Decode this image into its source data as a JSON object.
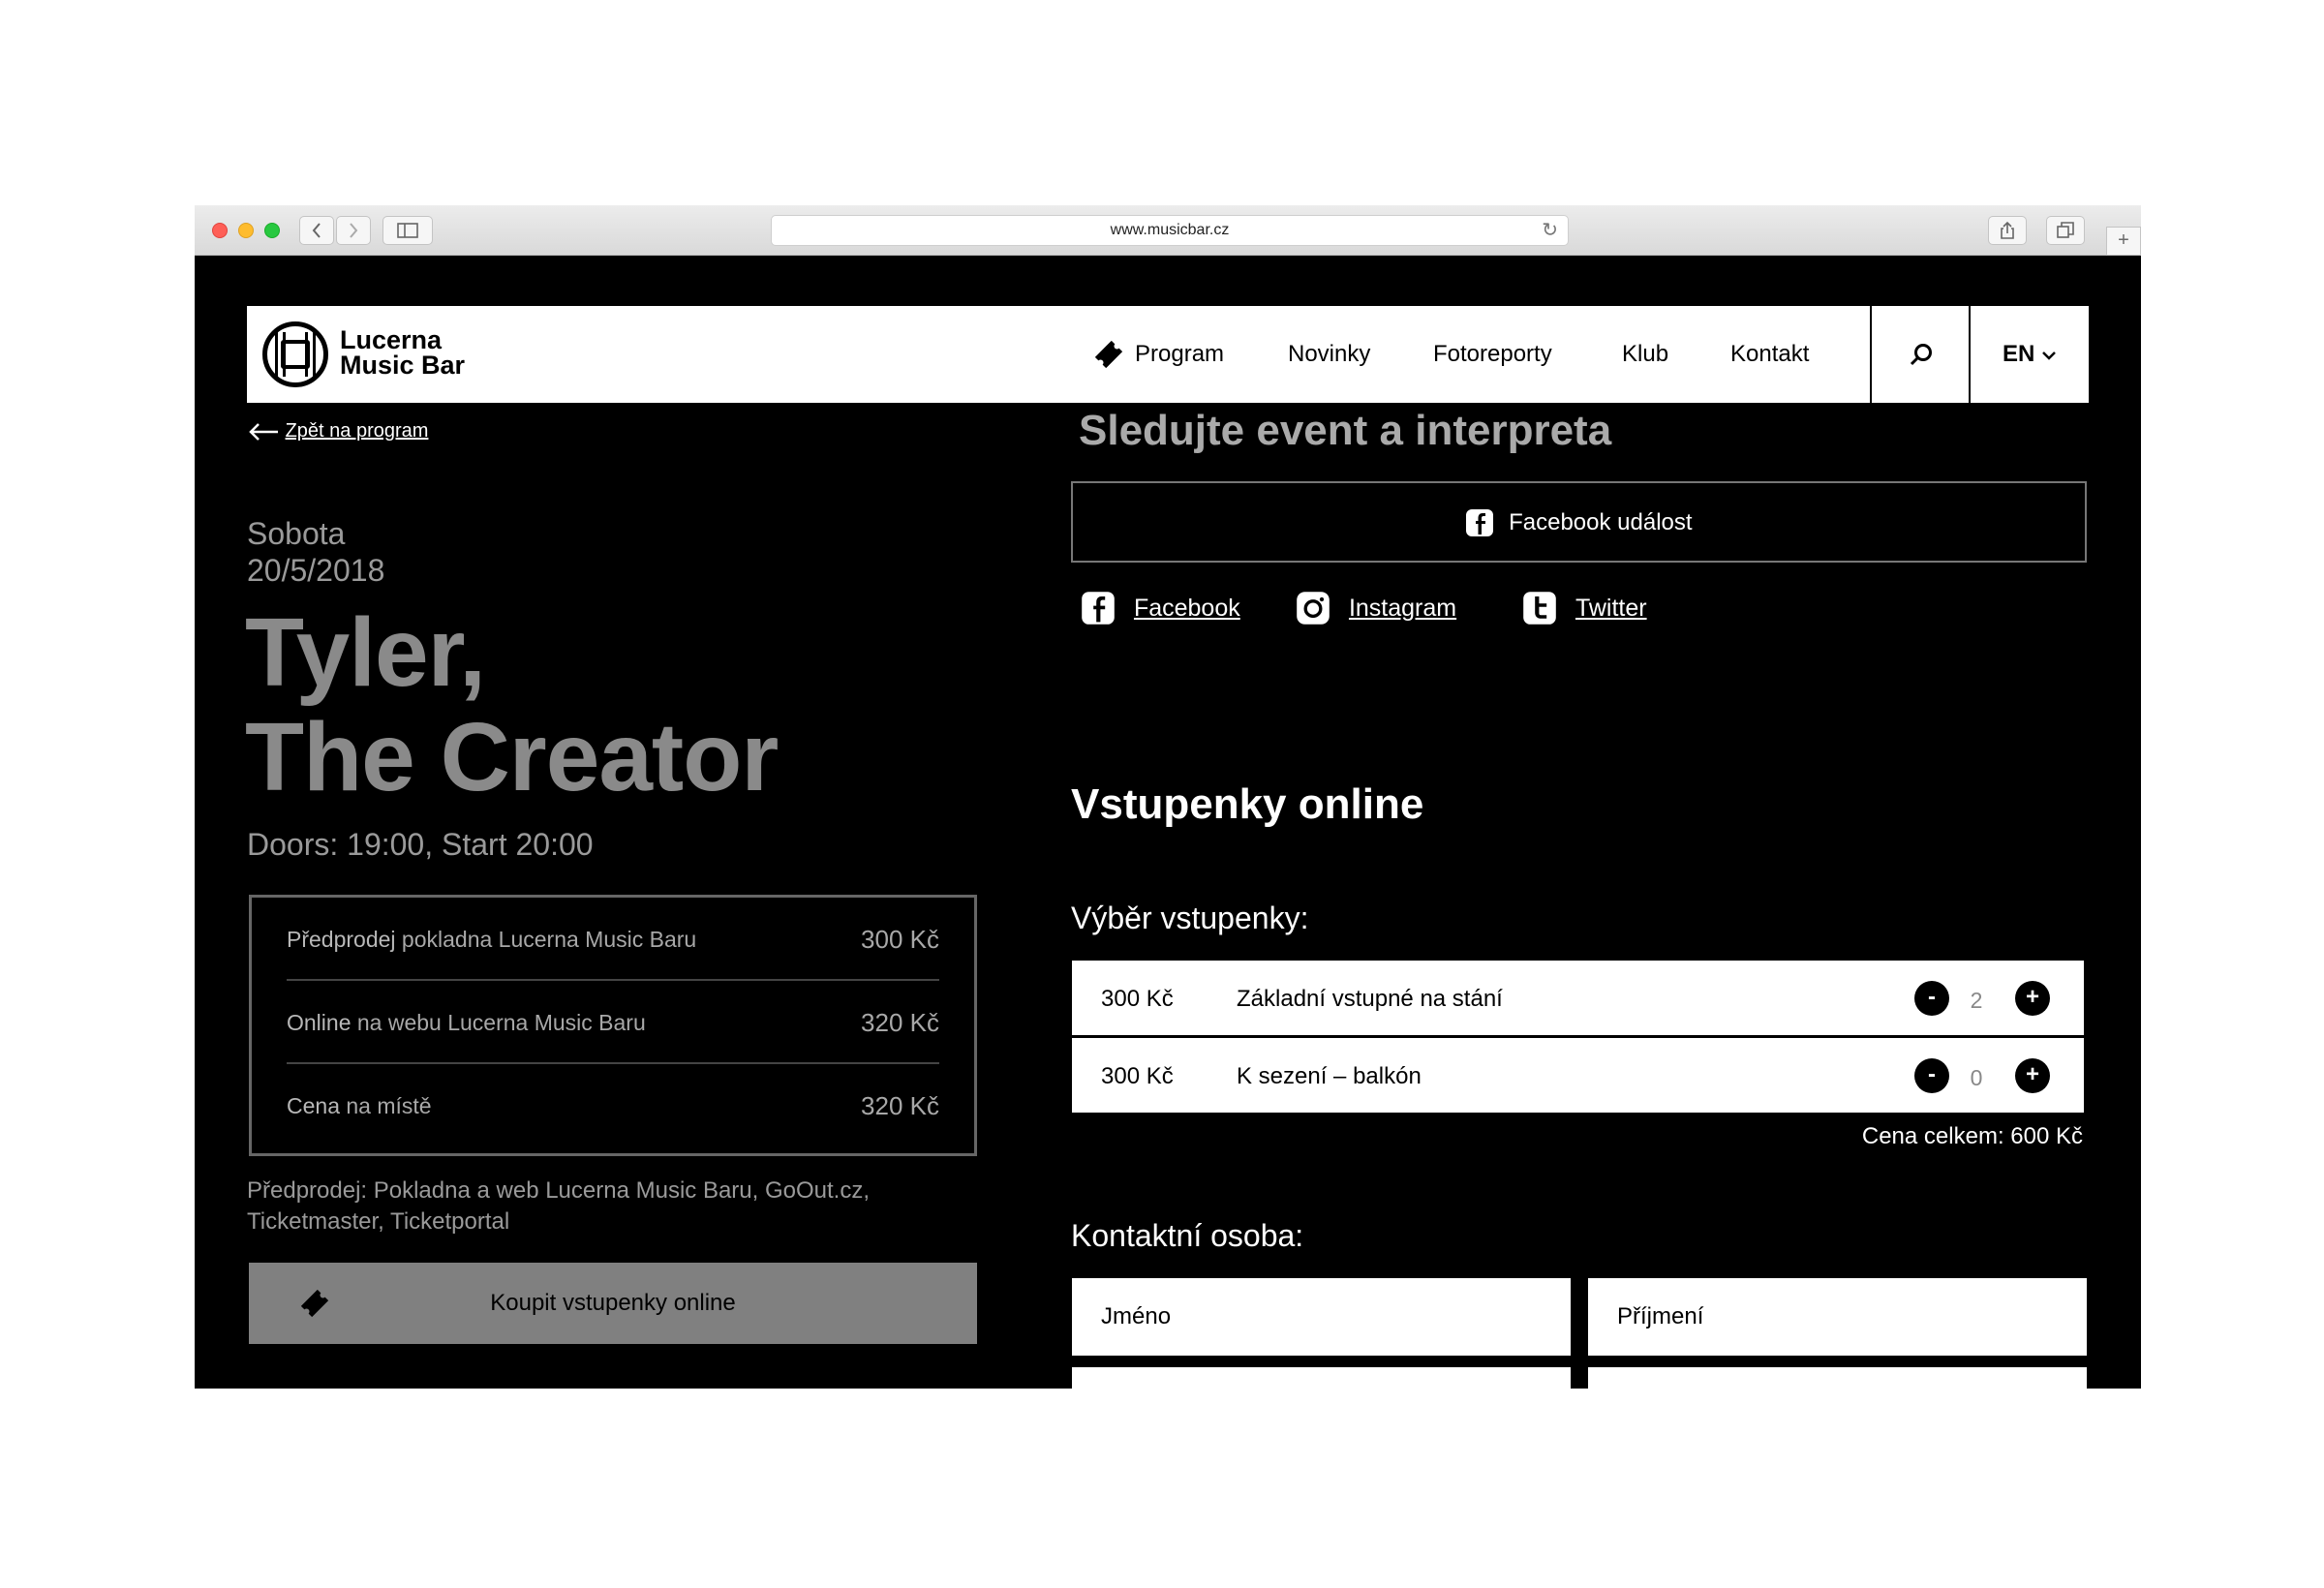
{
  "browser": {
    "url": "www.musicbar.cz"
  },
  "nav": {
    "brand_line1": "Lucerna",
    "brand_line2": "Music Bar",
    "items": [
      "Program",
      "Novinky",
      "Fotoreporty",
      "Klub",
      "Kontakt"
    ],
    "lang": "EN"
  },
  "event": {
    "back_label": "Zpět na program",
    "day": "Sobota",
    "date": "20/5/2018",
    "title_line1": "Tyler,",
    "title_line2": "The Creator",
    "doors": "Doors: 19:00, Start 20:00",
    "prices": [
      {
        "bold": "Předprodej",
        "rest": " pokladna Lucerna Music Baru",
        "price": "300 Kč"
      },
      {
        "bold": "Online",
        "rest": " na webu Lucerna Music Baru",
        "price": "320 Kč"
      },
      {
        "bold": "Cena",
        "rest": " na místě",
        "price": "320 Kč"
      }
    ],
    "presale_note": "Předprodej: Pokladna a web Lucerna Music Baru, GoOut.cz, Ticketmaster, Ticketportal",
    "buy_label": "Koupit vstupenky online"
  },
  "follow": {
    "title": "Sledujte event a interpreta",
    "fb_event": "Facebook událost",
    "facebook": "Facebook",
    "instagram": "Instagram",
    "twitter": "Twitter"
  },
  "tickets": {
    "title": "Vstupenky online",
    "select_title": "Výběr vstupenky:",
    "rows": [
      {
        "price": "300 Kč",
        "name": "Základní vstupné na stání",
        "qty": "2"
      },
      {
        "price": "300 Kč",
        "name": "K sezení – balkón",
        "qty": "0"
      }
    ],
    "minus": "-",
    "plus": "+",
    "total": "Cena celkem: 600 Kč"
  },
  "contact": {
    "title": "Kontaktní osoba:",
    "first_name_placeholder": "Jméno",
    "last_name_placeholder": "Příjmení"
  },
  "colors": {
    "page_bg": "#000000",
    "muted_text": "#8a8a8a",
    "button_gray": "#808080"
  }
}
